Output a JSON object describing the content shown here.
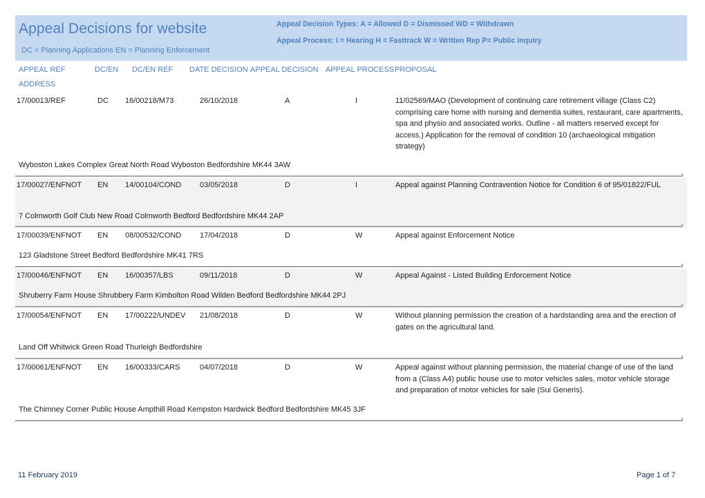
{
  "header": {
    "title": "Appeal Decisions for website",
    "subtitle": "DC = Planning Applications   EN = Planning Enforcement",
    "legend_decision_types": "Appeal Decision Types:   A = Allowed    D = Dismissed    WD = Withdrawn",
    "legend_appeal_process": "Appeal Process:    I = Hearing   H =  Fasttrack   W = Written Rep   P= Public Inquiry",
    "background_color": "#c5d9f1",
    "accent_color": "#4f81bd"
  },
  "columns": {
    "appeal_ref": "APPEAL REF",
    "dc_en": "DC/EN",
    "dc_en_ref": "DC/EN REF",
    "date_decision": "DATE DECISION",
    "appeal_decision": "APPEAL DECISION",
    "appeal_process": "APPEAL PROCESS",
    "proposal": "PROPOSAL",
    "address": "ADDRESS"
  },
  "records": [
    {
      "appeal_ref": "17/00013/REF",
      "dc_en": "DC",
      "dc_en_ref": "16/00218/M73",
      "date_decision": "26/10/2018",
      "appeal_decision": "A",
      "appeal_process": "I",
      "proposal": "11/02569/MAO (Development of continuing care retirement village (Class C2) comprising care home with nursing and dementia suites, restaurant, care apartments, spa and physio and associated works. Outline - all matters reserved except for access.) Application for the removal of condition 10 (archaeological mitigation strategy)",
      "address": "Wyboston Lakes Complex Great North Road Wyboston Bedfordshire MK44 3AW"
    },
    {
      "appeal_ref": "17/00027/ENFNOT",
      "dc_en": "EN",
      "dc_en_ref": "14/00104/COND",
      "date_decision": "03/05/2018",
      "appeal_decision": "D",
      "appeal_process": "I",
      "proposal": "Appeal against Planning Contravention Notice for Condition 6 of 95/01822/FUL",
      "address": "7 Colmworth Golf Club New Road Colmworth Bedford Bedfordshire MK44 2AP"
    },
    {
      "appeal_ref": "17/00039/ENFNOT",
      "dc_en": "EN",
      "dc_en_ref": "08/00532/COND",
      "date_decision": "17/04/2018",
      "appeal_decision": "D",
      "appeal_process": "W",
      "proposal": "Appeal against Enforcement Notice",
      "address": "123 Gladstone Street Bedford Bedfordshire MK41 7RS"
    },
    {
      "appeal_ref": "17/00046/ENFNOT",
      "dc_en": "EN",
      "dc_en_ref": "16/00357/LBS",
      "date_decision": "09/11/2018",
      "appeal_decision": "D",
      "appeal_process": "W",
      "proposal": "Appeal Against - Listed Building Enforcement Notice",
      "address": "Shruberry Farm House Shrubbery Farm Kimbolton Road Wilden Bedford Bedfordshire MK44 2PJ"
    },
    {
      "appeal_ref": "17/00054/ENFNOT",
      "dc_en": "EN",
      "dc_en_ref": "17/00222/UNDEV",
      "date_decision": "21/08/2018",
      "appeal_decision": "D",
      "appeal_process": "W",
      "proposal": "Without planning permission the creation of a hardstanding area and the erection of gates on the agricultural land.",
      "address": "Land Off Whitwick Green Road Thurleigh Bedfordshire"
    },
    {
      "appeal_ref": "17/00061/ENFNOT",
      "dc_en": "EN",
      "dc_en_ref": "16/00333/CARS",
      "date_decision": "04/07/2018",
      "appeal_decision": "D",
      "appeal_process": "W",
      "proposal": "Appeal against without planning permission, the material change of use of the land from a (Class A4) public house use to motor vehicles sales, motor vehicle storage and preparation of motor vehicles for sale (Sui Generis).",
      "address": "The Chimney Corner Public House Ampthill Road Kempston Hardwick Bedford Bedfordshire MK45 3JF"
    }
  ],
  "footer": {
    "date": "11 February 2019",
    "page": "Page 1 of 7"
  }
}
